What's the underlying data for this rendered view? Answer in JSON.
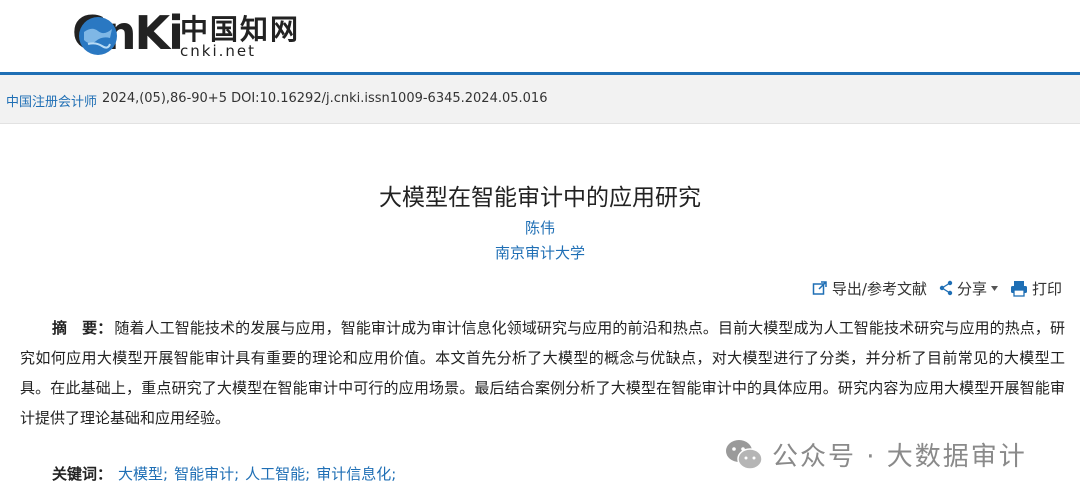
{
  "header": {
    "logo_latin": "CnKi",
    "logo_cn": "中国知网",
    "logo_domain": "cnki.net"
  },
  "citation": {
    "journal": "中国注册会计师",
    "meta": "2024,(05),86-90+5 DOI:10.16292/j.cnki.issn1009-6345.2024.05.016"
  },
  "article": {
    "title": "大模型在智能审计中的应用研究",
    "author": "陈伟",
    "institution": "南京审计大学"
  },
  "toolbar": {
    "export_label": "导出/参考文献",
    "share_label": "分享",
    "print_label": "打印"
  },
  "abstract": {
    "label": "摘　要：",
    "text": "随着人工智能技术的发展与应用，智能审计成为审计信息化领域研究与应用的前沿和热点。目前大模型成为人工智能技术研究与应用的热点，研究如何应用大模型开展智能审计具有重要的理论和应用价值。本文首先分析了大模型的概念与优缺点，对大模型进行了分类，并分析了目前常见的大模型工具。在此基础上，重点研究了大模型在智能审计中可行的应用场景。最后结合案例分析了大模型在智能审计中的具体应用。研究内容为应用大模型开展智能审计提供了理论基础和应用经验。"
  },
  "keywords": {
    "label": "关键词：",
    "items": [
      "大模型;",
      "智能审计;",
      "人工智能;",
      "审计信息化;"
    ]
  },
  "watermark": {
    "text": "公众号 · 大数据审计"
  },
  "colors": {
    "accent": "#1f6fb5",
    "cite_bar": "#f2f2f2"
  }
}
